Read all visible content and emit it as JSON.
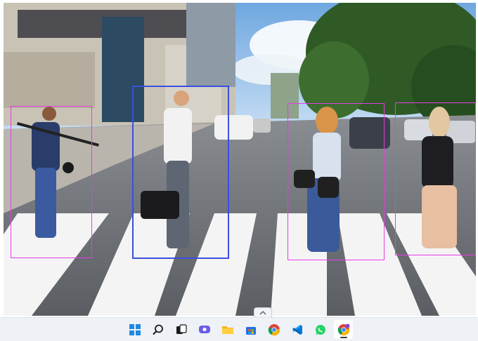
{
  "scene": {
    "description_visible": false
  },
  "detections": {
    "colors": {
      "primary": "#3b4fe0",
      "secondary": "#e63be6"
    },
    "count": 4
  },
  "taskbar": {
    "icons": [
      "windows-start-icon",
      "search-icon",
      "task-view-icon",
      "chat-icon",
      "file-explorer-icon",
      "store-icon",
      "chrome-icon",
      "vscode-icon",
      "whatsapp-icon",
      "chrome-active-icon"
    ],
    "active_index": 9
  }
}
